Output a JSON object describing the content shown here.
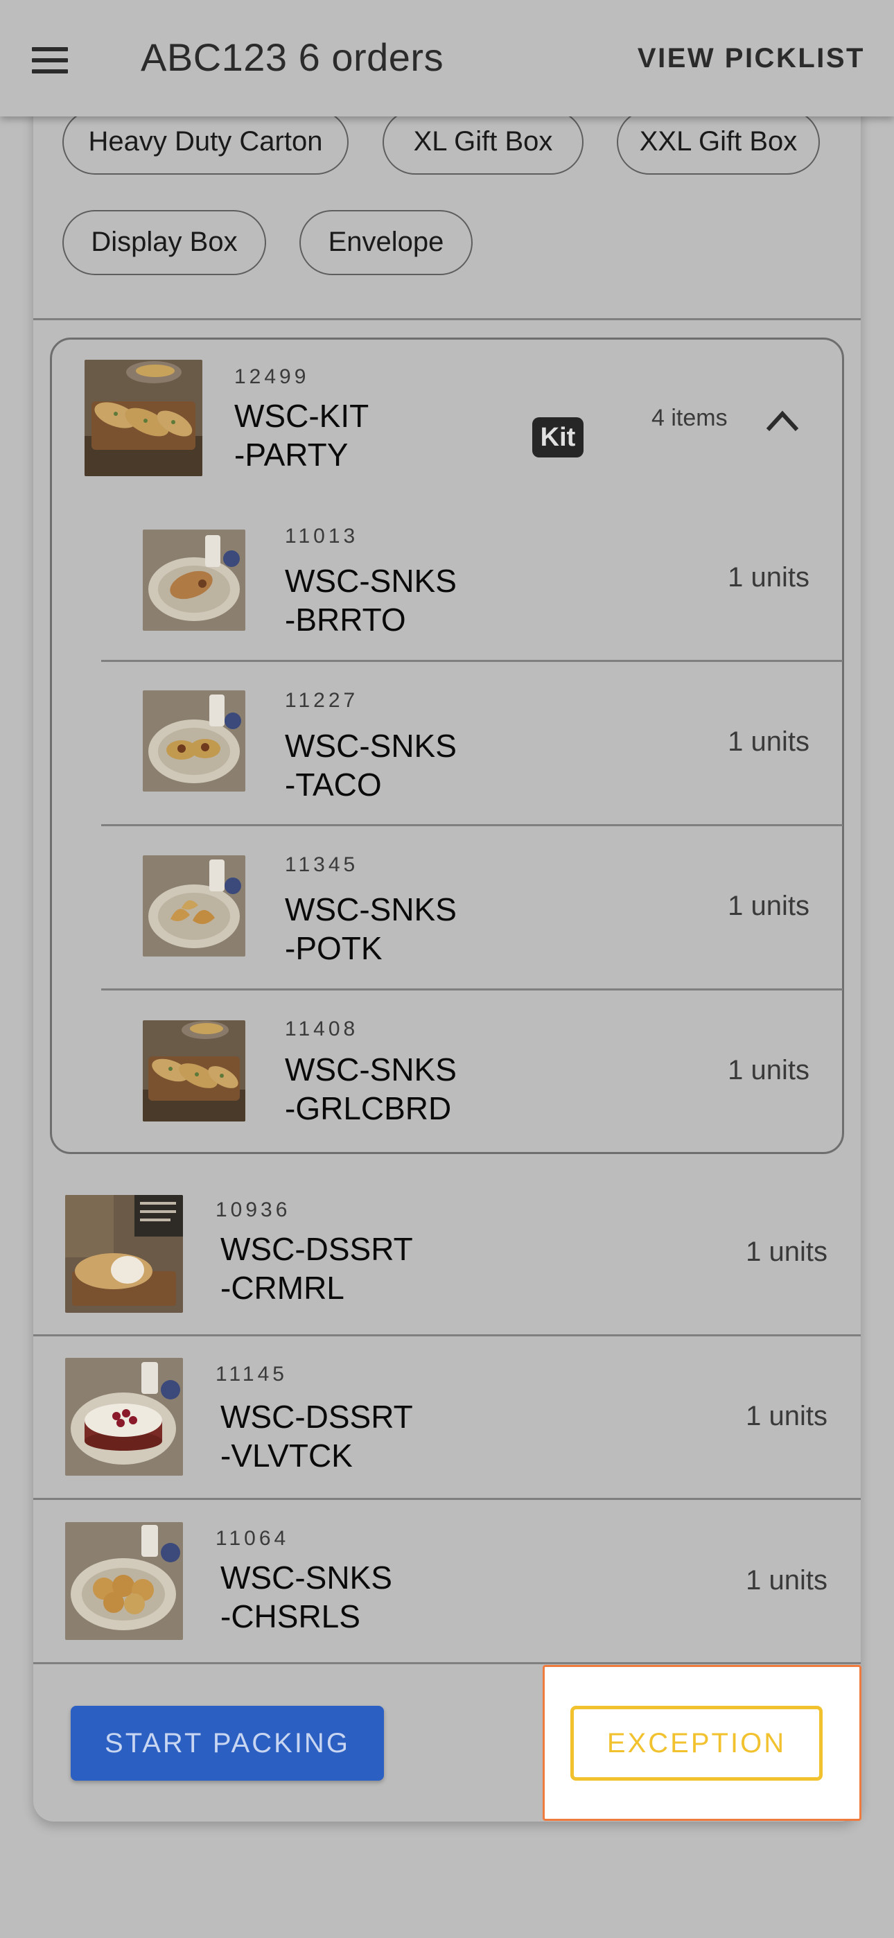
{
  "appbar": {
    "title": "ABC123 6 orders",
    "action_label": "VIEW PICKLIST"
  },
  "box_types": [
    "Heavy Duty Carton",
    "XL Gift Box",
    "XXL Gift Box",
    "Display Box",
    "Envelope"
  ],
  "kit": {
    "number": "12499",
    "sku_line1": "WSC-KIT",
    "sku_line2": "-PARTY",
    "badge": "Kit",
    "items_count": "4 items",
    "components": [
      {
        "number": "11013",
        "sku_line1": "WSC-SNKS",
        "sku_line2": "-BRRTO",
        "units": "1 units",
        "image": "burrito-plate"
      },
      {
        "number": "11227",
        "sku_line1": "WSC-SNKS",
        "sku_line2": "-TACO",
        "units": "1 units",
        "image": "taco-plate"
      },
      {
        "number": "11345",
        "sku_line1": "WSC-SNKS",
        "sku_line2": "-POTK",
        "units": "1 units",
        "image": "potsticker-plate"
      },
      {
        "number": "11408",
        "sku_line1": "WSC-SNKS",
        "sku_line2": "-GRLCBRD",
        "units": "1 units",
        "image": "garlic-bread-board"
      }
    ]
  },
  "items": [
    {
      "number": "10936",
      "sku_line1": "WSC-DSSRT",
      "sku_line2": "-CRMRL",
      "units": "1 units",
      "image": "cream-roll-board"
    },
    {
      "number": "11145",
      "sku_line1": "WSC-DSSRT",
      "sku_line2": "-VLVTCK",
      "units": "1 units",
      "image": "velvet-cake-plate"
    },
    {
      "number": "11064",
      "sku_line1": "WSC-SNKS",
      "sku_line2": "-CHSRLS",
      "units": "1 units",
      "image": "cheese-rolls-plate"
    }
  ],
  "actions": {
    "start_label": "START PACKING",
    "exception_label": "EXCEPTION"
  },
  "colors": {
    "background": "#bdbdbd",
    "primary": "#2b5fc2",
    "exception": "#f2c12e",
    "highlight_border": "#f07b3f"
  }
}
